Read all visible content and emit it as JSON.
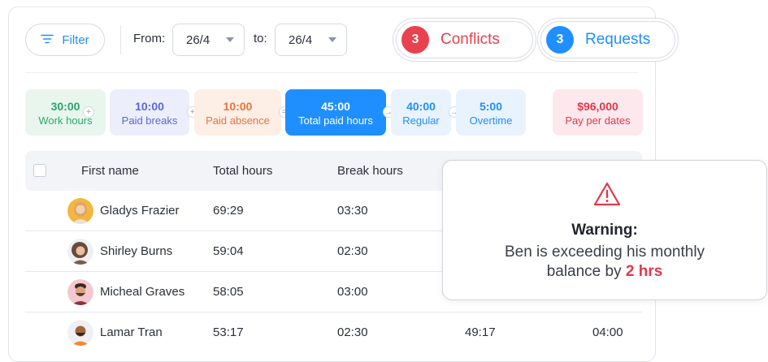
{
  "toolbar": {
    "filter_label": "Filter",
    "from_label": "From:",
    "from_value": "26/4",
    "to_label": "to:",
    "to_value": "26/4",
    "conflicts": {
      "count": "3",
      "label": "Conflicts",
      "color": "#e9414e"
    },
    "requests": {
      "count": "3",
      "label": "Requests",
      "color": "#1f8fff"
    }
  },
  "stats": [
    {
      "value": "30:00",
      "label": "Work hours",
      "bg": "#e8f6ee",
      "fg": "#2aa76a"
    },
    {
      "value": "10:00",
      "label": "Paid breaks",
      "bg": "#eceefb",
      "fg": "#5868d8"
    },
    {
      "value": "10:00",
      "label": "Paid absence",
      "bg": "#fdeee6",
      "fg": "#e6753d"
    },
    {
      "value": "45:00",
      "label": "Total paid hours",
      "bg": "#1f8fff",
      "fg": "#ffffff"
    },
    {
      "value": "40:00",
      "label": "Regular",
      "bg": "#e9f3fd",
      "fg": "#1f8fff"
    },
    {
      "value": "5:00",
      "label": "Overtime",
      "bg": "#e9f3fd",
      "fg": "#1f8fff"
    },
    {
      "value": "$96,000",
      "label": "Pay per dates",
      "bg": "#fde8ee",
      "fg": "#e0394a"
    }
  ],
  "operators": [
    "+",
    "+",
    "=",
    "→",
    "→"
  ],
  "table": {
    "headers": [
      "First name",
      "Total hours",
      "Break hours"
    ],
    "rows": [
      {
        "name": "Gladys Frazier",
        "total": "69:29",
        "break": "03:30",
        "col4": "",
        "col5": ""
      },
      {
        "name": "Shirley Burns",
        "total": "59:04",
        "break": "02:30",
        "col4": "",
        "col5": ""
      },
      {
        "name": "Micheal Graves",
        "total": "58:05",
        "break": "03:00",
        "col4": "",
        "col5": ""
      },
      {
        "name": "Lamar Tran",
        "total": "53:17",
        "break": "02:30",
        "col4": "49:17",
        "col5": "04:00"
      }
    ]
  },
  "warning": {
    "title": "Warning:",
    "line1": "Ben is exceeding his monthly",
    "line2_prefix": "balance by",
    "highlight": "2 hrs",
    "icon": "warning-triangle-icon",
    "icon_color": "#e0394a"
  }
}
